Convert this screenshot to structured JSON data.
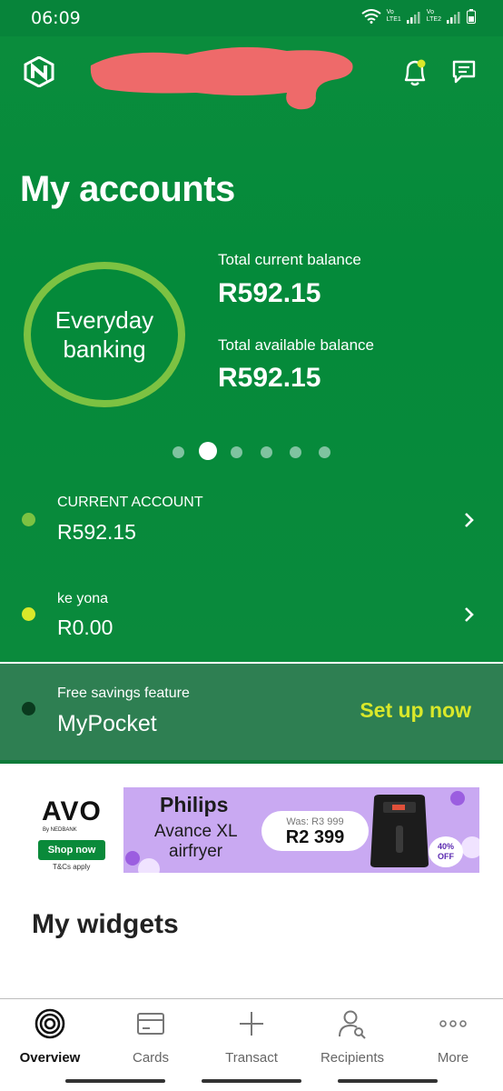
{
  "status": {
    "time": "06:09",
    "sim1": "LTE1",
    "sim2": "LTE2",
    "carrier": "Vo"
  },
  "header": {
    "logo_icon": "nedbank-logo-icon",
    "notification_icon": "bell-icon",
    "chat_icon": "chat-icon"
  },
  "page_title": "My accounts",
  "summary": {
    "ring_label": "Everyday banking",
    "current_label": "Total current balance",
    "current_value": "R592.15",
    "available_label": "Total available balance",
    "available_value": "R592.15",
    "carousel_pages": 6,
    "carousel_active": 2
  },
  "accounts": [
    {
      "name": "CURRENT ACCOUNT",
      "amount": "R592.15",
      "dot_color": "#7cc242"
    },
    {
      "name": "ke yona",
      "amount": "R0.00",
      "dot_color": "#d9e82a"
    }
  ],
  "pocket": {
    "label": "Free savings feature",
    "name": "MyPocket",
    "cta": "Set up now"
  },
  "banner": {
    "brand": "AVO",
    "brand_sub": "By NEDBANK",
    "shop_label": "Shop now",
    "terms": "T&Cs apply",
    "product_line1": "Philips",
    "product_line2": "Avance XL",
    "product_line3": "airfryer",
    "was_price": "Was: R3 999",
    "now_price": "R2 399",
    "badge_pct": "40%",
    "badge_off": "OFF"
  },
  "widgets_title": "My widgets",
  "nav": [
    {
      "label": "Overview",
      "icon": "overview-icon",
      "active": true
    },
    {
      "label": "Cards",
      "icon": "card-icon",
      "active": false
    },
    {
      "label": "Transact",
      "icon": "plus-icon",
      "active": false
    },
    {
      "label": "Recipients",
      "icon": "recipients-icon",
      "active": false
    },
    {
      "label": "More",
      "icon": "more-icon",
      "active": false
    }
  ],
  "colors": {
    "brand_green": "#07843a",
    "ring_green": "#7cc242",
    "accent_yellow": "#d9e82a",
    "pocket_bg": "#2e7f52",
    "ad_purple": "#c9a9f2"
  }
}
